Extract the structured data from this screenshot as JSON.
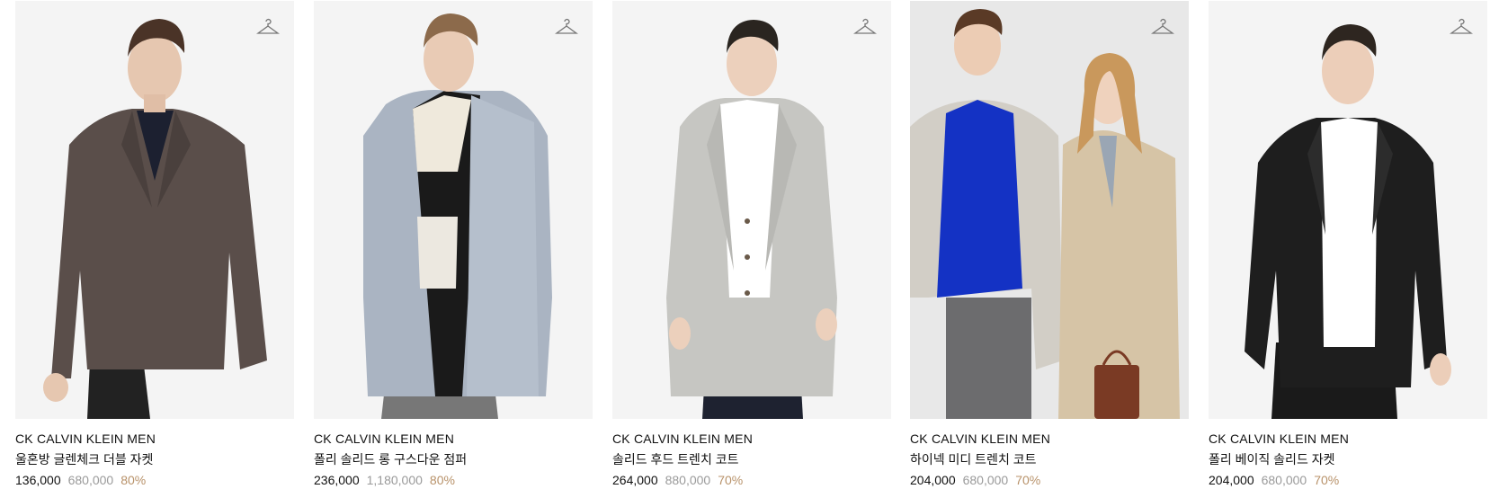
{
  "colors": {
    "accent_discount": "#b8926a",
    "original_price": "#9a9a9a",
    "text": "#111111",
    "photo_bg": "#f4f4f4"
  },
  "products": [
    {
      "brand": "CK CALVIN KLEIN MEN",
      "name": "울혼방 글렌체크 더블 자켓",
      "sale_price": "136,000",
      "original_price": "680,000",
      "discount": "80%",
      "icon": "hanger-icon",
      "garment_color": "#5a4e4a"
    },
    {
      "brand": "CK CALVIN KLEIN MEN",
      "name": "폴리 솔리드 롱 구스다운 점퍼",
      "sale_price": "236,000",
      "original_price": "1,180,000",
      "discount": "80%",
      "icon": "hanger-icon",
      "garment_color": "#aab4c2"
    },
    {
      "brand": "CK CALVIN KLEIN MEN",
      "name": "솔리드 후드 트렌치 코트",
      "sale_price": "264,000",
      "original_price": "880,000",
      "discount": "70%",
      "icon": "hanger-icon",
      "garment_color": "#c6c6c2"
    },
    {
      "brand": "CK CALVIN KLEIN MEN",
      "name": "하이넥 미디 트렌치 코트",
      "sale_price": "204,000",
      "original_price": "680,000",
      "discount": "70%",
      "icon": "hanger-icon",
      "garment_color": "#d6d0c4"
    },
    {
      "brand": "CK CALVIN KLEIN MEN",
      "name": "폴리 베이직 솔리드 자켓",
      "sale_price": "204,000",
      "original_price": "680,000",
      "discount": "70%",
      "icon": "hanger-icon",
      "garment_color": "#1e1e1e"
    }
  ]
}
